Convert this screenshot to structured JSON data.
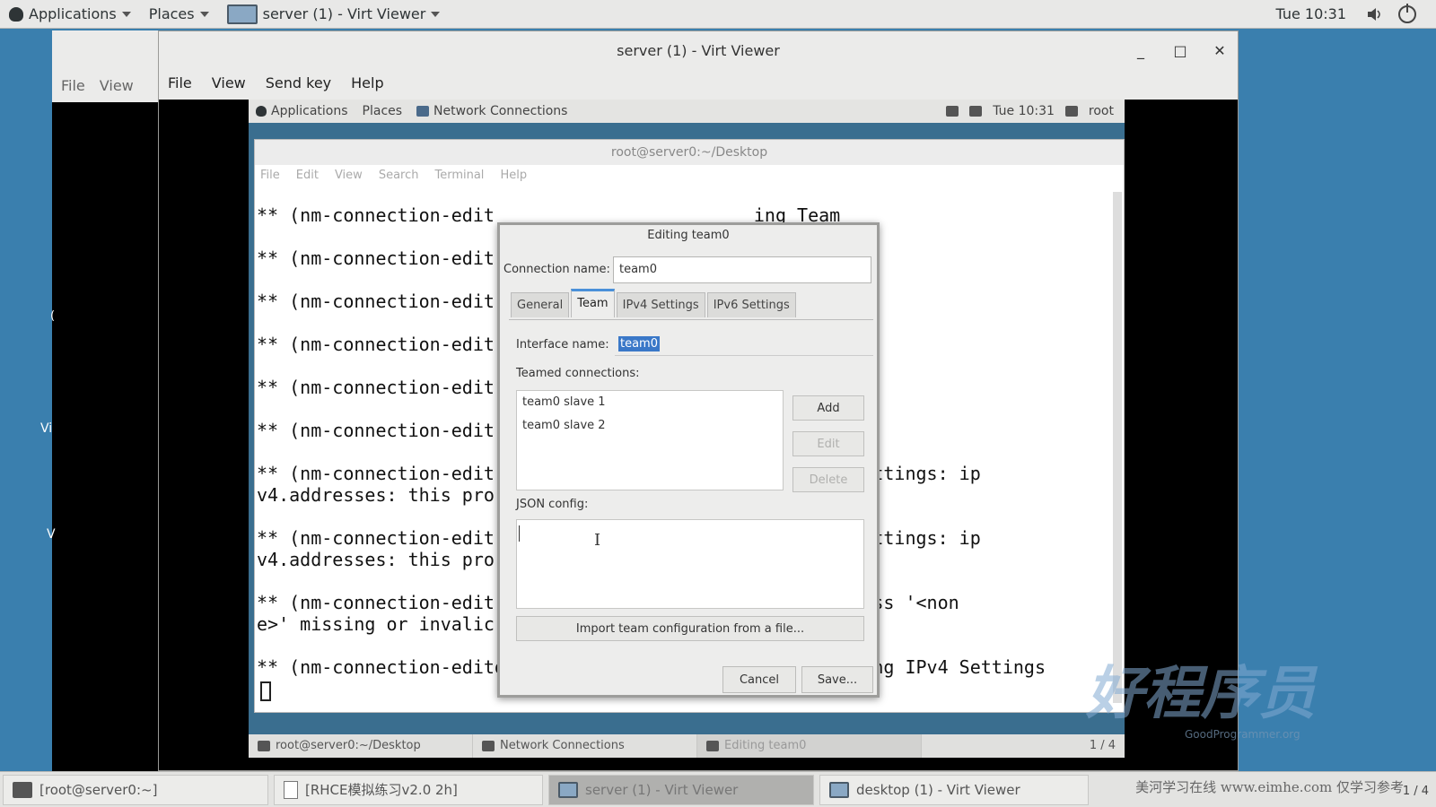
{
  "host": {
    "topbar": {
      "applications": "Applications",
      "places": "Places",
      "active_window": "server (1) - Virt Viewer",
      "clock": "Tue 10:31"
    },
    "bg_window": {
      "menu": [
        "File",
        "View"
      ]
    },
    "desktop_labels": [
      "(",
      "Vi",
      "V"
    ],
    "taskbar": [
      {
        "label": "[root@server0:~]"
      },
      {
        "label": "[RHCE模拟练习v2.0 2h]"
      },
      {
        "label": "server (1) - Virt Viewer"
      },
      {
        "label": "desktop (1) - Virt Viewer"
      }
    ],
    "watermark_text": "美河学习在线 www.eimhe.com 仅学习参考",
    "page_indicator": "1 / 4"
  },
  "viewer": {
    "title": "server (1) - Virt Viewer",
    "menu": [
      "File",
      "View",
      "Send key",
      "Help"
    ]
  },
  "guest": {
    "topbar": {
      "applications": "Applications",
      "places": "Places",
      "active_window": "Network Connections",
      "clock": "Tue 10:31",
      "user": "root"
    },
    "terminal": {
      "title": "root@server0:~/Desktop",
      "menu": [
        "File",
        "Edit",
        "View",
        "Search",
        "Terminal",
        "Help"
      ],
      "lines": [
        "** (nm-connection-edit                        ing Team",
        "",
        "** (nm-connection-edit                        ing Team",
        "",
        "** (nm-connection-edit                        ing Team",
        "",
        "** (nm-connection-edit                        ing Team",
        "",
        "** (nm-connection-edit                        ing Team",
        "",
        "** (nm-connection-edit                        ing Team",
        "",
        "** (nm-connection-edit                        ing IPv4 Settings: ip",
        "v4.addresses: this pro                        manual'",
        "",
        "** (nm-connection-edit                        ing IPv4 Settings: ip",
        "v4.addresses: this pro                        manual'",
        "",
        "** (nm-connection-edit                      g: IPv4 address '<non",
        "e>' missing or invalic",
        "",
        "** (nm-connection-editor:3577): WARNING **: Invalid setting IPv4 Settings"
      ]
    },
    "dialog": {
      "title": "Editing team0",
      "connection_name_label": "Connection name:",
      "connection_name_value": "team0",
      "tabs": [
        "General",
        "Team",
        "IPv4 Settings",
        "IPv6 Settings"
      ],
      "active_tab": "Team",
      "interface_name_label": "Interface name:",
      "interface_name_value": "team0",
      "teamed_connections_label": "Teamed connections:",
      "teamed_connections": [
        "team0 slave 1",
        "team0 slave 2"
      ],
      "add_button": "Add",
      "edit_button": "Edit",
      "delete_button": "Delete",
      "json_config_label": "JSON config:",
      "json_config_value": "",
      "import_button": "Import team configuration from a file...",
      "cancel_button": "Cancel",
      "save_button": "Save..."
    },
    "taskbar": [
      {
        "label": "root@server0:~/Desktop"
      },
      {
        "label": "Network Connections"
      },
      {
        "label": "Editing team0"
      }
    ],
    "page_indicator": "1 / 4"
  },
  "watermark": {
    "main": "好程序员",
    "sub": "GoodProgrammer.org"
  },
  "colors": {
    "desktop": "#3a7fae",
    "selection": "#3a78c8",
    "tab_accent": "#4a90d9"
  }
}
